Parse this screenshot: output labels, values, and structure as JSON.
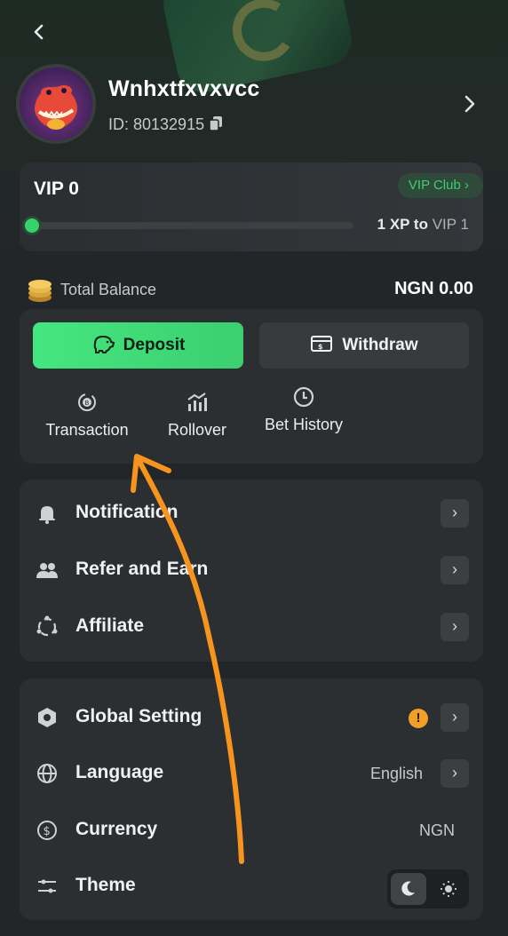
{
  "header": {
    "back_label": "‹",
    "username": "Wnhxtfxvxvcc",
    "user_id": "ID: 80132915",
    "profile_chevron": "›"
  },
  "vip": {
    "level": "VIP 0",
    "club_label": "VIP Club",
    "club_chevron": "›",
    "progress_fraction": 0.0,
    "xp_text": "1 XP to",
    "next_level": "VIP 1"
  },
  "balance": {
    "label": "Total Balance",
    "value": "NGN 0.00"
  },
  "actions": {
    "deposit_label": "Deposit",
    "withdraw_label": "Withdraw",
    "quick": [
      {
        "label": "Transaction",
        "icon": "transaction-icon"
      },
      {
        "label": "Rollover",
        "icon": "rollover-icon"
      },
      {
        "label": "Bet History",
        "icon": "clock-icon"
      }
    ]
  },
  "menu1": [
    {
      "label": "Notification",
      "icon": "bell-icon"
    },
    {
      "label": "Refer and Earn",
      "icon": "users-icon"
    },
    {
      "label": "Affiliate",
      "icon": "affiliate-icon"
    }
  ],
  "menu2": {
    "global_setting": {
      "label": "Global Setting",
      "icon": "settings-hex-icon",
      "alert": "!"
    },
    "language": {
      "label": "Language",
      "value": "English",
      "icon": "globe-icon"
    },
    "currency": {
      "label": "Currency",
      "value": "NGN",
      "icon": "dollar-circle-icon"
    },
    "theme": {
      "label": "Theme",
      "icon": "sliders-icon",
      "selected": "dark"
    }
  },
  "colors": {
    "accent_green": "#3ccf6f",
    "background": "#232628",
    "card": "#2c2f32",
    "warning": "#f0a02a",
    "annotation_arrow": "#f7941d"
  }
}
